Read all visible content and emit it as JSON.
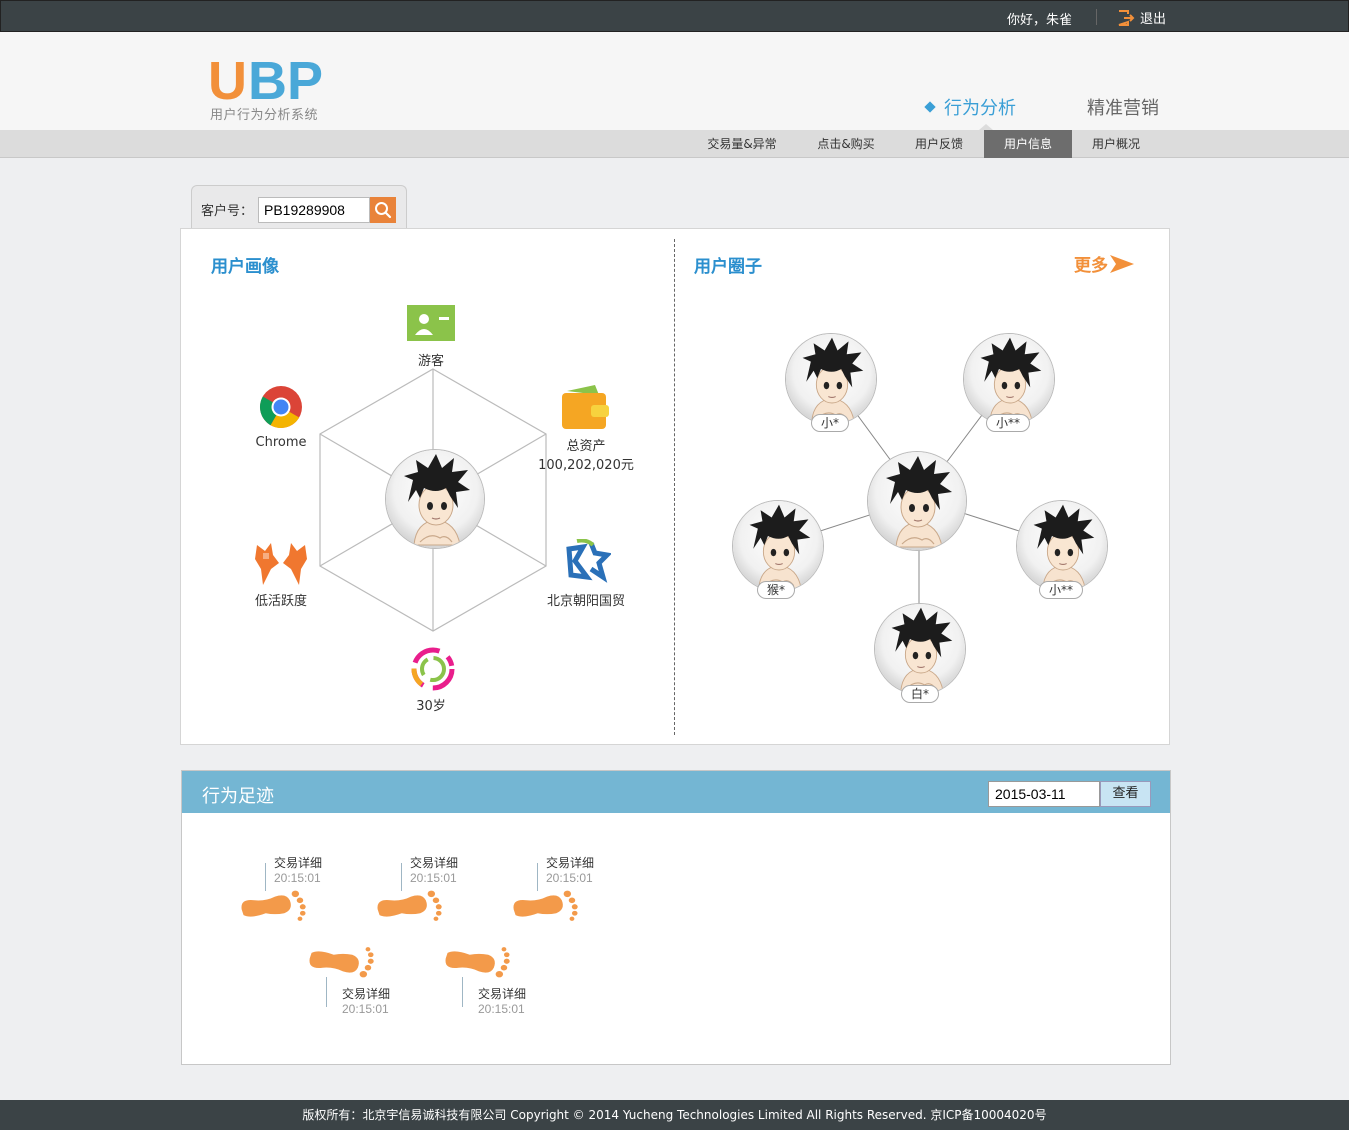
{
  "topbar": {
    "greeting": "你好，朱雀",
    "logout_label": "退出"
  },
  "logo": {
    "letter_u": "U",
    "letters_bp": "BP",
    "subtitle": "用户行为分析系统"
  },
  "main_nav": [
    {
      "label": "行为分析",
      "active": true
    },
    {
      "label": "精准营销",
      "active": false
    }
  ],
  "sub_nav": [
    {
      "label": "交易量&异常",
      "active": false
    },
    {
      "label": "点击&购买",
      "active": false
    },
    {
      "label": "用户反馈",
      "active": false
    },
    {
      "label": "用户信息",
      "active": true
    },
    {
      "label": "用户概况",
      "active": false
    }
  ],
  "search": {
    "label": "客户号：",
    "value": "PB19289908"
  },
  "profile": {
    "title": "用户画像",
    "attributes": {
      "visitor": "游客",
      "assets_label": "总资产",
      "assets_value": "100,202,020元",
      "location": "北京朝阳国贸",
      "age": "30岁",
      "activity": "低活跃度",
      "browser": "Chrome"
    }
  },
  "circle": {
    "title": "用户圈子",
    "more_label": "更多",
    "friends": [
      "小*",
      "小**",
      "猴*",
      "小**",
      "白*"
    ]
  },
  "footprint": {
    "title": "行为足迹",
    "date": "2015-03-11",
    "view_label": "查看",
    "items": [
      {
        "detail": "交易详细",
        "time": "20:15:01"
      },
      {
        "detail": "交易详细",
        "time": "20:15:01"
      },
      {
        "detail": "交易详细",
        "time": "20:15:01"
      },
      {
        "detail": "交易详细",
        "time": "20:15:01"
      },
      {
        "detail": "交易详细",
        "time": "20:15:01"
      }
    ]
  },
  "footer": {
    "text": "版权所有：北京宇信易诚科技有限公司 Copyright © 2014 Yucheng Technologies Limited All Rights Reserved. 京ICP备10004020号"
  },
  "colors": {
    "brand_orange": "#f2903a",
    "brand_blue": "#4aa8d8",
    "title_blue": "#2b8fce",
    "header_bar": "#74b6d3",
    "dark_bar": "#3b4346"
  }
}
